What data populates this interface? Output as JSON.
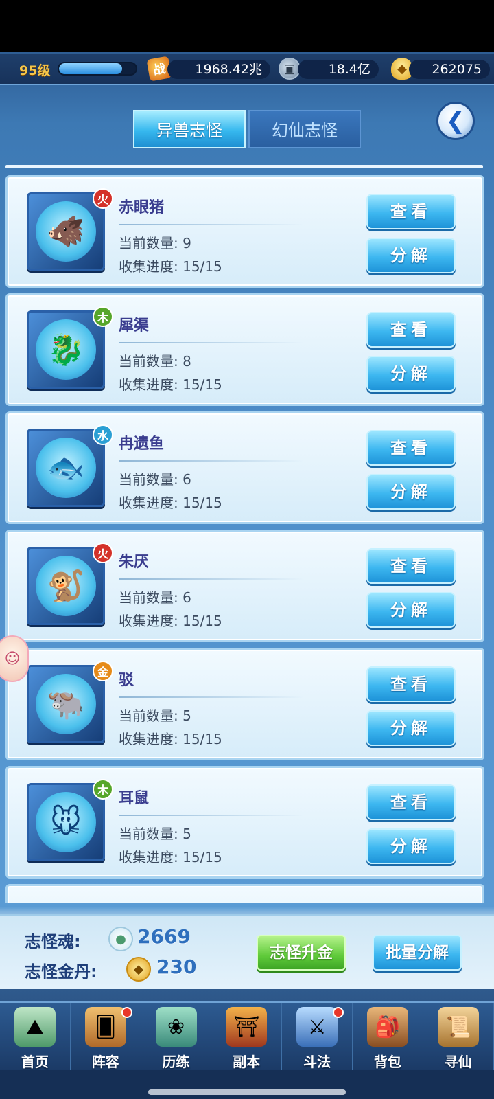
{
  "resources": {
    "level": "95级",
    "level_progress": 0.82,
    "battle_icon": "战",
    "battle_power": "1968.42兆",
    "coin": "18.4亿",
    "gold": "262075"
  },
  "tabs": [
    {
      "label": "异兽志怪",
      "active": true
    },
    {
      "label": "幻仙志怪",
      "active": false
    }
  ],
  "back_icon": "back-arrow-icon",
  "labels": {
    "count_prefix": "当前数量: ",
    "progress_prefix": "收集进度: ",
    "view": "查看",
    "decompose": "分解"
  },
  "beasts": [
    {
      "name": "赤眼猪",
      "element": "火",
      "element_color": "#d4322a",
      "count_text": "当前数量: 9",
      "progress_text": "收集进度: 15/15"
    },
    {
      "name": "犀渠",
      "element": "木",
      "element_color": "#56a62a",
      "count_text": "当前数量: 8",
      "progress_text": "收集进度: 15/15"
    },
    {
      "name": "冉遗鱼",
      "element": "水",
      "element_color": "#2a9fd4",
      "count_text": "当前数量: 6",
      "progress_text": "收集进度: 15/15"
    },
    {
      "name": "朱厌",
      "element": "火",
      "element_color": "#d4322a",
      "count_text": "当前数量: 6",
      "progress_text": "收集进度: 15/15"
    },
    {
      "name": "驳",
      "element": "金",
      "element_color": "#e68b19",
      "count_text": "当前数量: 5",
      "progress_text": "收集进度: 15/15"
    },
    {
      "name": "耳鼠",
      "element": "木",
      "element_color": "#56a62a",
      "count_text": "当前数量: 5",
      "progress_text": "收集进度: 15/15"
    }
  ],
  "bottom_panel": {
    "soul_label": "志怪魂:",
    "soul_value": "2669",
    "dan_label": "志怪金丹:",
    "dan_value": "230",
    "upgrade_button": "志怪升金",
    "batch_button": "批量分解"
  },
  "nav": [
    {
      "label": "首页",
      "icon": "home-island-icon",
      "dot": false
    },
    {
      "label": "阵容",
      "icon": "lineup-cards-icon",
      "dot": true
    },
    {
      "label": "历练",
      "icon": "training-icon",
      "dot": false
    },
    {
      "label": "副本",
      "icon": "dungeon-gate-icon",
      "dot": false
    },
    {
      "label": "斗法",
      "icon": "arena-icon",
      "dot": true
    },
    {
      "label": "背包",
      "icon": "backpack-icon",
      "dot": false
    },
    {
      "label": "寻仙",
      "icon": "scroll-icon",
      "dot": false
    }
  ]
}
